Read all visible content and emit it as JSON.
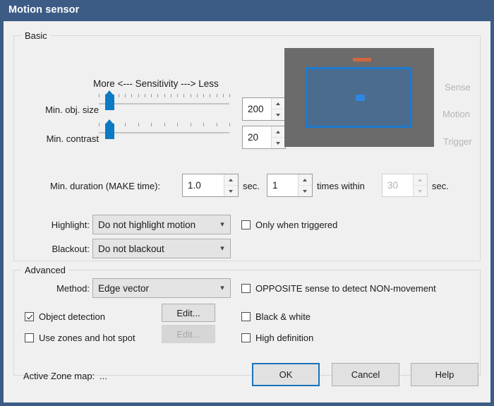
{
  "window": {
    "title": "Motion sensor",
    "titlebar_color": "#3c5c86",
    "client_bg": "#f0f0f0"
  },
  "basic": {
    "group_label": "Basic",
    "sensitivity_caption": "More <--- Sensitivity ---> Less",
    "sliders": [
      {
        "label": "Min. obj. size",
        "value": "200",
        "thumb_percent": 8,
        "tick_count": 21
      },
      {
        "label": "Min. contrast",
        "value": "20",
        "thumb_percent": 8,
        "tick_count": 11
      }
    ],
    "duration": {
      "label": "Min. duration (MAKE time):",
      "value": "1.0",
      "unit_label": "sec.",
      "times_value": "1",
      "times_label": "times within",
      "within_value": "30",
      "within_unit_label": "sec.",
      "within_disabled": true
    },
    "highlight": {
      "label": "Highlight:",
      "value": "Do not highlight motion"
    },
    "blackout": {
      "label": "Blackout:",
      "value": "Do not blackout"
    },
    "only_when_triggered": {
      "label": "Only when triggered",
      "checked": false
    },
    "preview": {
      "status_labels": [
        "Sense",
        "Motion",
        "Trigger"
      ],
      "bg_color": "#6b6b6b",
      "zone_border_color": "#1b7ad0",
      "marker_color": "#d1673e"
    }
  },
  "advanced": {
    "group_label": "Advanced",
    "method": {
      "label": "Method:",
      "value": "Edge vector"
    },
    "opposite_sense": {
      "label": "OPPOSITE sense to detect NON-movement",
      "checked": false
    },
    "object_detection": {
      "label": "Object detection",
      "checked": true,
      "edit_label": "Edit...",
      "edit_disabled": false
    },
    "use_zones": {
      "label": "Use zones and hot spot",
      "checked": false,
      "edit_label": "Edit...",
      "edit_disabled": true
    },
    "black_and_white": {
      "label": "Black & white",
      "checked": false
    },
    "high_definition": {
      "label": "High definition",
      "checked": false
    }
  },
  "footer": {
    "active_zone_label": "Active Zone map:",
    "active_zone_value": "...",
    "ok_label": "OK",
    "cancel_label": "Cancel",
    "help_label": "Help",
    "focus_color": "#1b72b8"
  }
}
